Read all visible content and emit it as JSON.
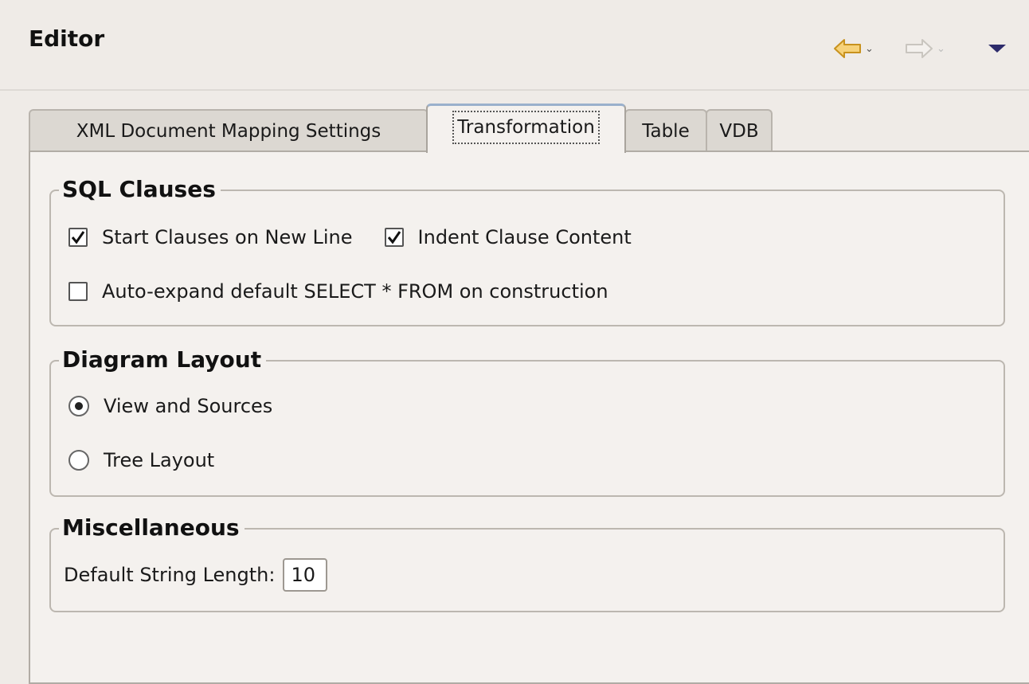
{
  "header": {
    "title": "Editor",
    "back_icon": "left-arrow-icon",
    "forward_icon": "right-arrow-icon",
    "menu_icon": "view-menu-icon"
  },
  "tabs": [
    {
      "label": "XML Document Mapping Settings",
      "active": false
    },
    {
      "label": "Transformation",
      "active": true
    },
    {
      "label": "Table",
      "active": false
    },
    {
      "label": "VDB",
      "active": false
    }
  ],
  "sql_clauses": {
    "title": "SQL Clauses",
    "start_clauses_label": "Start Clauses on New Line",
    "start_clauses_checked": true,
    "indent_clause_label": "Indent Clause Content",
    "indent_clause_checked": true,
    "auto_expand_label": "Auto-expand default SELECT * FROM on construction",
    "auto_expand_checked": false
  },
  "diagram_layout": {
    "title": "Diagram Layout",
    "options": [
      {
        "label": "View and Sources",
        "selected": true
      },
      {
        "label": "Tree Layout",
        "selected": false
      }
    ]
  },
  "miscellaneous": {
    "title": "Miscellaneous",
    "string_length_label": "Default String Length:",
    "string_length_value": "10"
  },
  "colors": {
    "back_arrow_fill": "#f7d27a",
    "back_arrow_stroke": "#c8921e",
    "menu_triangle": "#2d2b6b"
  }
}
